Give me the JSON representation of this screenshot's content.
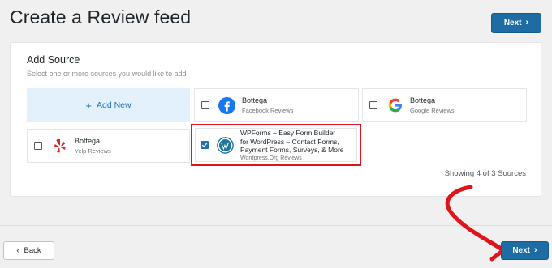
{
  "header": {
    "title": "Create a Review feed",
    "next_label": "Next"
  },
  "add_source": {
    "heading": "Add Source",
    "subtitle": "Select one or more sources you would like to add",
    "add_new_label": "Add New",
    "sources": [
      {
        "name": "Bottega",
        "type": "Facebook Reviews",
        "checked": false,
        "icon": "facebook-icon"
      },
      {
        "name": "Bottega",
        "type": "Google Reviews",
        "checked": false,
        "icon": "google-icon"
      },
      {
        "name": "Bottega",
        "type": "Yelp Reviews",
        "checked": false,
        "icon": "yelp-icon"
      },
      {
        "name_lines": [
          "WPForms – Easy Form Builder",
          "for WordPress – Contact Forms,",
          "Payment Forms, Surveys, & More"
        ],
        "type": "Wordpress.Org Reviews",
        "checked": true,
        "icon": "wordpress-icon"
      }
    ],
    "showing_text": "Showing 4 of 3 Sources"
  },
  "footer": {
    "back_label": "Back",
    "next_label": "Next"
  },
  "colors": {
    "primary": "#1e6ca4",
    "add_new_bg": "#e2f1fc",
    "highlight_annotation": "#e0141b"
  }
}
